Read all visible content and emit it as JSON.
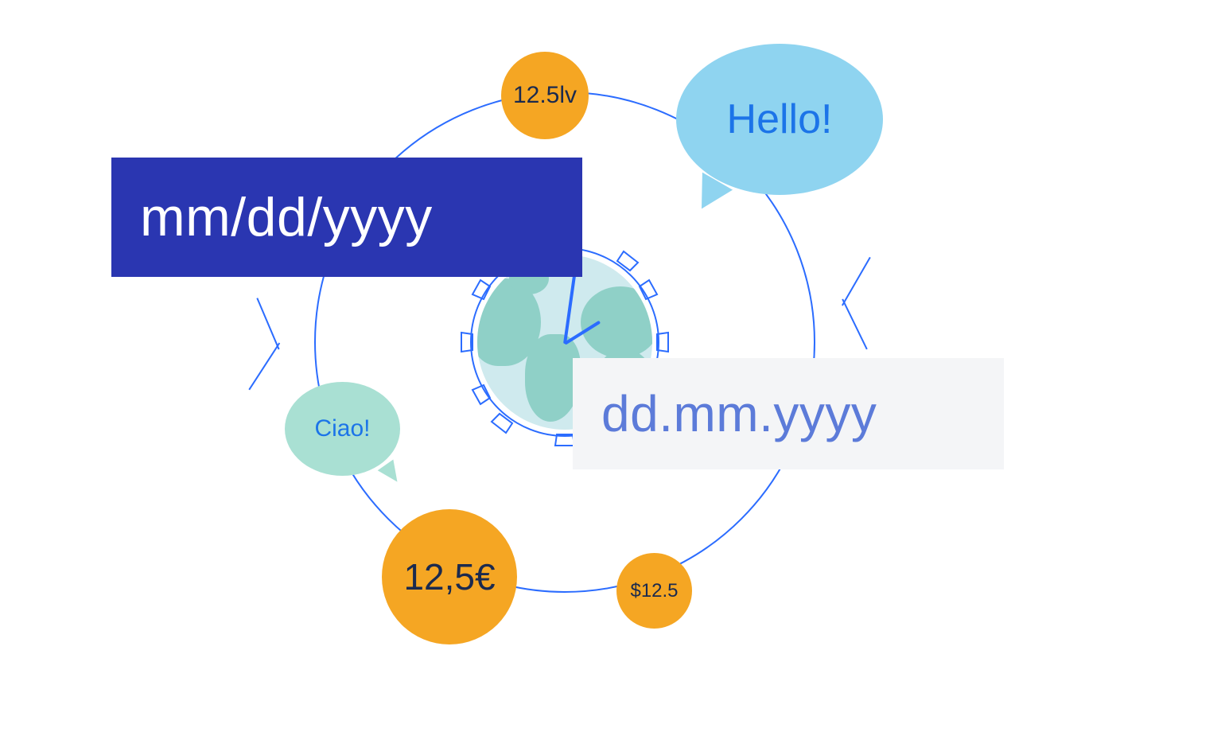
{
  "diagram": {
    "date_format_primary": "mm/dd/yyyy",
    "date_format_secondary": "dd.mm.yyyy",
    "greeting_en": "Hello!",
    "greeting_it": "Ciao!",
    "currency_lv": "12.5lv",
    "currency_eur": "12,5€",
    "currency_usd": "$12.5"
  },
  "colors": {
    "arc_stroke": "#2b6cff",
    "primary_box_bg": "#2a36b1",
    "primary_box_text": "#ffffff",
    "secondary_box_bg": "#f4f5f7",
    "secondary_box_text": "#5c7bd9",
    "coin_bg": "#f5a623",
    "coin_text": "#1b2a4e",
    "bubble_large_bg": "#8fd4f0",
    "bubble_small_bg": "#a9e0d3",
    "bubble_text": "#1c74e8",
    "globe_water": "#cfeaee",
    "globe_land": "#8fd0c7"
  }
}
